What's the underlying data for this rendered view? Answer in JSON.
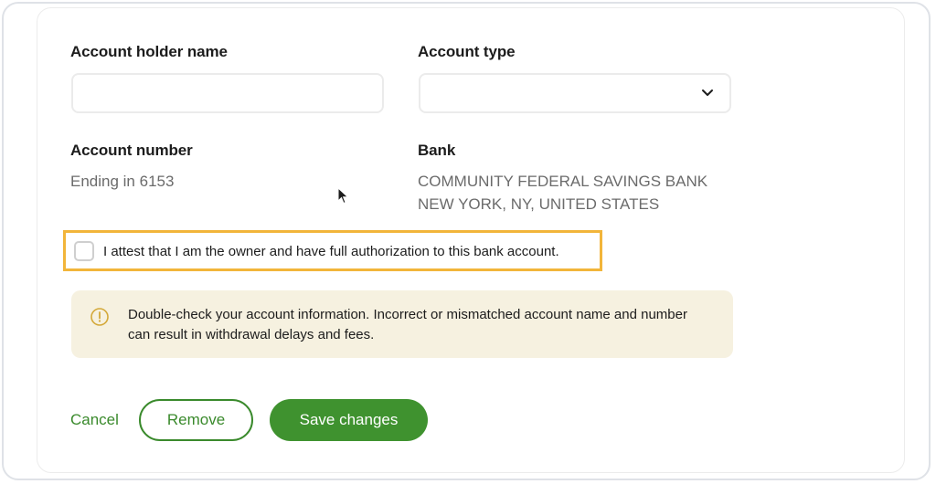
{
  "form": {
    "holder_name_label": "Account holder name",
    "holder_name_value": "",
    "account_type_label": "Account type",
    "account_type_value": "",
    "account_number_label": "Account number",
    "account_number_value": "Ending in 6153",
    "bank_label": "Bank",
    "bank_name": "COMMUNITY FEDERAL SAVINGS BANK",
    "bank_location": "NEW YORK, NY, UNITED STATES"
  },
  "attest": {
    "checked": false,
    "text": "I attest that I am the owner and have full authorization to this bank account."
  },
  "notice": {
    "icon": "warning-circle-icon",
    "text": "Double-check your account information. Incorrect or mismatched account name and number can result in withdrawal delays and fees."
  },
  "actions": {
    "cancel_label": "Cancel",
    "remove_label": "Remove",
    "save_label": "Save changes"
  },
  "colors": {
    "accent_green": "#3f922f",
    "highlight_outline": "#f2b53a",
    "notice_background": "#f6f1e0"
  }
}
